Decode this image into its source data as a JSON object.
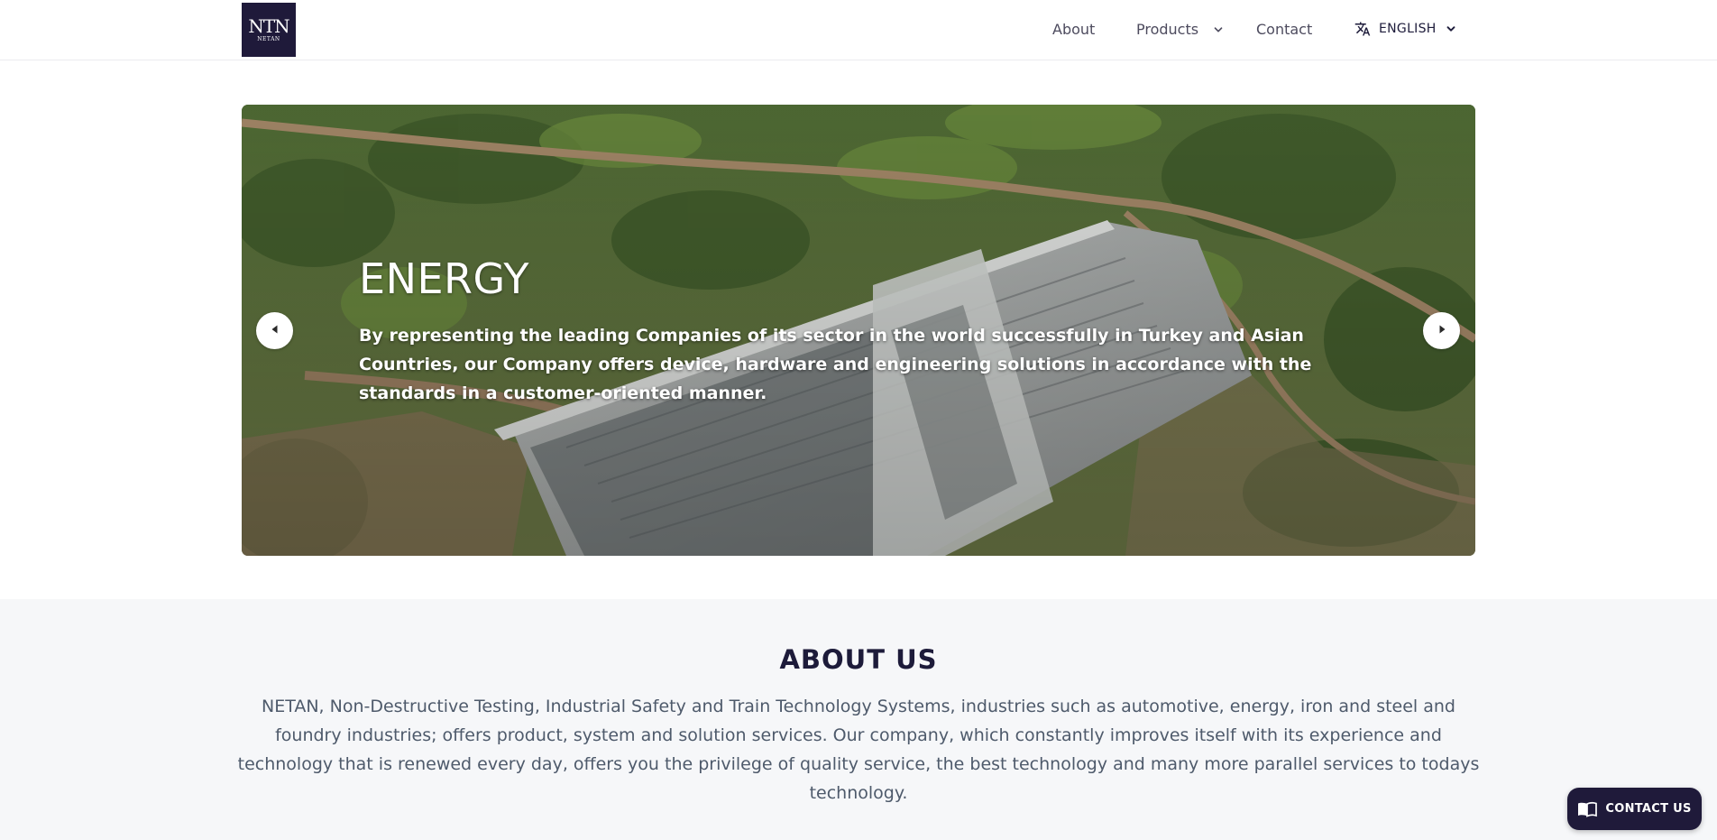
{
  "brand": {
    "logo_mark": "NTN",
    "logo_sub": "NETAN",
    "logo_bg": "#1f1a3a"
  },
  "nav": {
    "about": "About",
    "products": "Products",
    "contact": "Contact",
    "language": "ENGLISH",
    "icons": [
      "chevron-down-icon",
      "translate-icon"
    ]
  },
  "hero": {
    "title": "ENERGY",
    "text": "By representing the leading Companies of its sector in the world successfully in Turkey and Asian Countries, our Company offers device, hardware and engineering solutions in accordance with the standards in a customer-oriented manner.",
    "image": "aerial view of a concrete dam under construction in green hills",
    "controls": [
      "arrow-left-icon",
      "arrow-right-icon"
    ]
  },
  "about": {
    "title": "ABOUT US",
    "text": "NETAN, Non-Destructive Testing, Industrial Safety and Train Technology Systems, industries such as automotive, energy, iron and steel and foundry industries; offers product, system and solution services. Our company, which constantly improves itself with its experience and technology that is renewed every day, offers you the privilege of quality service, the best technology and many more parallel services to todays technology."
  },
  "contact_button": {
    "label": "CONTACT US",
    "icon": "book-icon",
    "bg": "#1f1a3a"
  }
}
